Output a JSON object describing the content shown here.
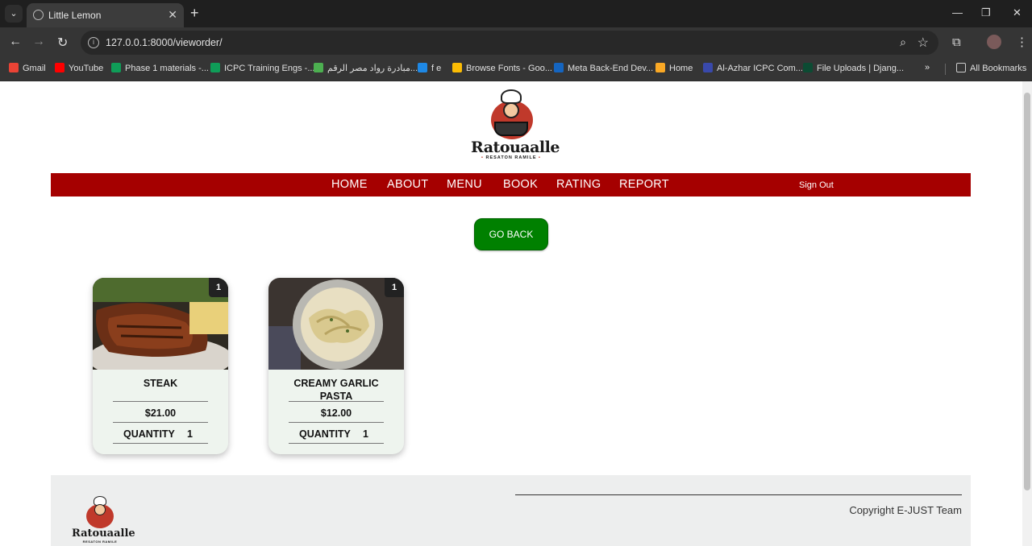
{
  "browser": {
    "tab_title": "Little Lemon",
    "url": "127.0.0.1:8000/vieworder/",
    "bookmarks": [
      {
        "label": "Gmail",
        "color": "#ea4335"
      },
      {
        "label": "YouTube",
        "color": "#ff0000"
      },
      {
        "label": "Phase 1 materials -...",
        "color": "#0f9d58"
      },
      {
        "label": "ICPC Training Engs -...",
        "color": "#0f9d58"
      },
      {
        "label": "مبادرة رواد مصر الرقم...",
        "color": "#4caf50"
      },
      {
        "label": "f e",
        "color": "#1e88e5"
      },
      {
        "label": "Browse Fonts - Goo...",
        "color": "#fbbc04"
      },
      {
        "label": "Meta Back-End Dev...",
        "color": "#1565c0"
      },
      {
        "label": "Home",
        "color": "#f9a825"
      },
      {
        "label": "Al-Azhar ICPC Com...",
        "color": "#3949ab"
      },
      {
        "label": "File Uploads | Djang...",
        "color": "#0c4b33"
      }
    ],
    "overflow_label": "»",
    "all_bookmarks": "All Bookmarks"
  },
  "site": {
    "logo_name": "Ratouaalle",
    "logo_tagline": "RESATON RAMILE",
    "nav": [
      "HOME",
      "ABOUT",
      "MENU",
      "BOOK",
      "RATING",
      "REPORT"
    ],
    "sign_out": "Sign Out",
    "go_back": "GO BACK"
  },
  "orders": [
    {
      "name": "STEAK",
      "price": "$21.00",
      "quantity_label": "QUANTITY",
      "quantity": "1",
      "badge": "1",
      "image": "steak"
    },
    {
      "name": "CREAMY GARLIC PASTA",
      "price": "$12.00",
      "quantity_label": "QUANTITY",
      "quantity": "1",
      "badge": "1",
      "image": "pasta"
    }
  ],
  "footer": {
    "copyright": "Copyright E-JUST Team"
  },
  "colors": {
    "navbar": "#a50000",
    "go_back": "#008000",
    "card_bg": "#eef4ee",
    "footer_bg": "#edeeee"
  }
}
